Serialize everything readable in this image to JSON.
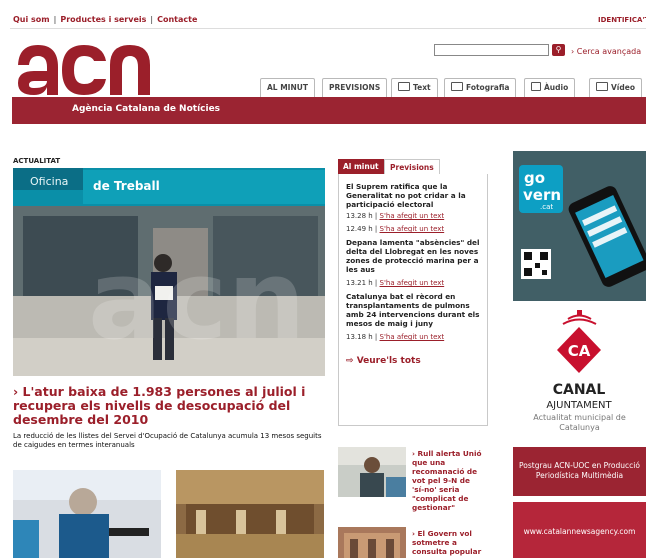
{
  "topnav": {
    "items": [
      "Qui som",
      "Productes i serveis",
      "Contacte"
    ],
    "identifica": "IDENTIFICA'T"
  },
  "brand": {
    "logo_text": "acn",
    "subtitle": "Agència Catalana de Notícies",
    "color": "#9b1f2a"
  },
  "search": {
    "button_icon": "search-icon",
    "advanced_label": "› Cerca avançada"
  },
  "tabs": [
    "AL MINUT",
    "PREVISIONS",
    "Text",
    "Fotografia",
    "Àudio",
    "Vídeo"
  ],
  "actualitat": {
    "label": "ACTUALITAT",
    "photo_sign_1": "Oficina",
    "photo_sign_2": "de Treball",
    "title": "› L'atur baixa de 1.983 persones al juliol i recupera els nivells de desocupació del desembre del 2010",
    "summary": "La reducció de les llistes del Servei d'Ocupació de Catalunya acumula 13 mesos seguits de caigudes en termes interanuals"
  },
  "minut": {
    "tab_active": "Al minut",
    "tab_other": "Previsions",
    "items": [
      {
        "headline": "El Suprem ratifica que la Generalitat no pot cridar a la participació electoral"
      },
      {
        "time": "13.28 h",
        "link": "S'ha afegit un text"
      },
      {
        "time": "12.49 h",
        "link": "S'ha afegit un text"
      },
      {
        "headline": "Depana lamenta \"absències\" del delta del Llobregat en les noves zones de protecció marina per a les aus"
      },
      {
        "time": "13.21 h",
        "link": "S'ha afegit un text"
      },
      {
        "headline": "Catalunya bat el rècord en transplantaments de pulmons amb 24 intervencions durant els mesos de maig i juny"
      },
      {
        "time": "13.18 h",
        "link": "S'ha afegit un text"
      }
    ],
    "veure": "Veure'ls tots"
  },
  "side_news": [
    {
      "title": "› Rull alerta Unió que una recomanació de vot pel 9-N de 'sí-no' seria \"complicat de gestionar\""
    },
    {
      "title": "› El Govern vol sotmetre a consulta popular"
    }
  ],
  "ads": {
    "govern_1": "go",
    "govern_2": "vern",
    "govern_3": ".cat",
    "canal_logo": "CA",
    "canal": "CANAL",
    "ajuntament": "AJUNTAMENT",
    "canal_sub": "Actualitat municipal de Catalunya",
    "postgrau": "Postgrau ACN-UOC en Producció Periodística Multimèdia",
    "url": "www.catalannewsagency.com"
  }
}
